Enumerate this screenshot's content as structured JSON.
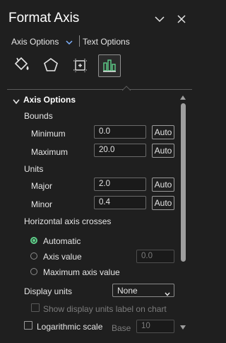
{
  "header": {
    "title": "Format Axis"
  },
  "menu": {
    "axis_options": "Axis Options",
    "text_options": "Text Options"
  },
  "tabs": [
    {
      "name": "fill-line",
      "icon": "paint-bucket-icon"
    },
    {
      "name": "effects",
      "icon": "pentagon-icon"
    },
    {
      "name": "size-properties",
      "icon": "size-grid-icon"
    },
    {
      "name": "axis-options",
      "icon": "bar-chart-icon",
      "active": true
    }
  ],
  "section": {
    "title": "Axis Options"
  },
  "bounds": {
    "heading": "Bounds",
    "minimum_label": "Minimum",
    "minimum_value": "0.0",
    "maximum_label": "Maximum",
    "maximum_value": "20.0",
    "auto": "Auto"
  },
  "units": {
    "heading": "Units",
    "major_label": "Major",
    "major_value": "2.0",
    "minor_label": "Minor",
    "minor_value": "0.4",
    "auto": "Auto"
  },
  "crosses": {
    "heading": "Horizontal axis crosses",
    "automatic": "Automatic",
    "axis_value": "Axis value",
    "axis_value_input": "0.0",
    "maximum": "Maximum axis value",
    "selected": "automatic"
  },
  "display_units": {
    "label": "Display units",
    "selected": "None",
    "show_label": "Show display units label on chart"
  },
  "log_scale": {
    "label": "Logarithmic scale",
    "base_label": "Base",
    "base_value": "10"
  },
  "colors": {
    "bg": "#1f1f1f",
    "accent": "#5fd08a"
  }
}
